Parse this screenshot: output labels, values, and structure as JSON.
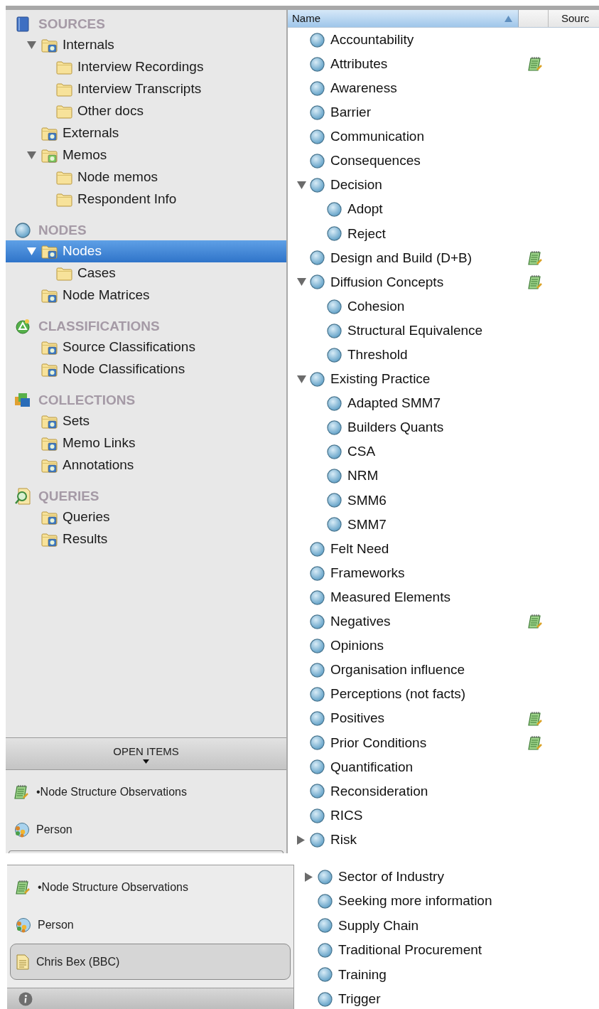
{
  "top_view": {
    "sidebar": {
      "sections": [
        {
          "title": "SOURCES",
          "kind": "sources",
          "items": [
            {
              "label": "Internals",
              "kind": "badged-folder",
              "expanded": true,
              "selected": false,
              "children": [
                {
                  "label": "Interview Recordings",
                  "kind": "folder",
                  "selected": false
                },
                {
                  "label": "Interview Transcripts",
                  "kind": "folder",
                  "selected": false
                },
                {
                  "label": "Other docs",
                  "kind": "folder",
                  "selected": false
                }
              ]
            },
            {
              "label": "Externals",
              "kind": "badged-folder",
              "selected": false
            },
            {
              "label": "Memos",
              "kind": "memo-folder",
              "expanded": true,
              "selected": false,
              "children": [
                {
                  "label": "Node memos",
                  "kind": "folder",
                  "selected": false
                },
                {
                  "label": "Respondent Info",
                  "kind": "folder",
                  "selected": false
                }
              ]
            }
          ]
        },
        {
          "title": "NODES",
          "kind": "nodes",
          "items": [
            {
              "label": "Nodes",
              "kind": "badged-folder",
              "expanded": true,
              "selected": true,
              "children": [
                {
                  "label": "Cases",
                  "kind": "folder",
                  "selected": false
                }
              ]
            },
            {
              "label": "Node Matrices",
              "kind": "badged-folder",
              "selected": false
            }
          ]
        },
        {
          "title": "CLASSIFICATIONS",
          "kind": "classifications",
          "items": [
            {
              "label": "Source Classifications",
              "kind": "badged-folder",
              "selected": false
            },
            {
              "label": "Node Classifications",
              "kind": "badged-folder",
              "selected": false
            }
          ]
        },
        {
          "title": "COLLECTIONS",
          "kind": "collections",
          "items": [
            {
              "label": "Sets",
              "kind": "badged-folder",
              "selected": false
            },
            {
              "label": "Memo Links",
              "kind": "badged-folder",
              "selected": false
            },
            {
              "label": "Annotations",
              "kind": "badged-folder",
              "selected": false
            }
          ]
        },
        {
          "title": "QUERIES",
          "kind": "queries",
          "items": [
            {
              "label": "Queries",
              "kind": "badged-folder",
              "selected": false
            },
            {
              "label": "Results",
              "kind": "badged-folder",
              "selected": false
            }
          ]
        }
      ]
    },
    "open_items": {
      "title": "OPEN ITEMS",
      "items": [
        {
          "label": "•Node Structure Observations",
          "kind": "memo",
          "selected": false
        },
        {
          "label": "Person",
          "kind": "classification",
          "selected": false
        }
      ]
    },
    "node_list": {
      "columns": [
        "Name",
        "Sourc"
      ],
      "rows": [
        {
          "label": "Accountability",
          "memo": false
        },
        {
          "label": "Attributes",
          "memo": true
        },
        {
          "label": "Awareness",
          "memo": false
        },
        {
          "label": "Barrier",
          "memo": false
        },
        {
          "label": "Communication",
          "memo": false
        },
        {
          "label": "Consequences",
          "memo": false
        },
        {
          "label": "Decision",
          "expanded": true,
          "memo": false,
          "children": [
            {
              "label": "Adopt",
              "memo": false
            },
            {
              "label": "Reject",
              "memo": false
            }
          ]
        },
        {
          "label": "Design and Build (D+B)",
          "memo": true
        },
        {
          "label": "Diffusion Concepts",
          "expanded": true,
          "memo": true,
          "children": [
            {
              "label": "Cohesion",
              "memo": false
            },
            {
              "label": "Structural Equivalence",
              "memo": false
            },
            {
              "label": "Threshold",
              "memo": false
            }
          ]
        },
        {
          "label": "Existing Practice",
          "expanded": true,
          "memo": false,
          "children": [
            {
              "label": "Adapted SMM7",
              "memo": false
            },
            {
              "label": "Builders Quants",
              "memo": false
            },
            {
              "label": "CSA",
              "memo": false
            },
            {
              "label": "NRM",
              "memo": false
            },
            {
              "label": "SMM6",
              "memo": false
            },
            {
              "label": "SMM7",
              "memo": false
            }
          ]
        },
        {
          "label": "Felt Need",
          "memo": false
        },
        {
          "label": "Frameworks",
          "memo": false
        },
        {
          "label": "Measured Elements",
          "memo": false
        },
        {
          "label": "Negatives",
          "memo": true
        },
        {
          "label": "Opinions",
          "memo": false
        },
        {
          "label": "Organisation influence",
          "memo": false
        },
        {
          "label": "Perceptions (not facts)",
          "memo": false
        },
        {
          "label": "Positives",
          "memo": true
        },
        {
          "label": "Prior Conditions",
          "memo": true
        },
        {
          "label": "Quantification",
          "memo": false
        },
        {
          "label": "Reconsideration",
          "memo": false
        },
        {
          "label": "RICS",
          "memo": false
        },
        {
          "label": "Risk",
          "expanded": false,
          "memo": false
        }
      ]
    }
  },
  "bottom_view": {
    "open_items": {
      "items": [
        {
          "label": "•Node Structure Observations",
          "kind": "memo",
          "selected": false
        },
        {
          "label": "Person",
          "kind": "classification",
          "selected": false
        },
        {
          "label": "Chris Bex (BBC)",
          "kind": "document",
          "selected": true
        }
      ]
    },
    "node_list": {
      "rows": [
        {
          "label": "Sector of Industry",
          "expanded": false,
          "memo": false
        },
        {
          "label": "Seeking more information",
          "memo": false
        },
        {
          "label": "Supply Chain",
          "memo": false
        },
        {
          "label": "Traditional Procurement",
          "memo": false
        },
        {
          "label": "Training",
          "memo": false
        },
        {
          "label": "Trigger",
          "memo": false
        }
      ]
    }
  }
}
